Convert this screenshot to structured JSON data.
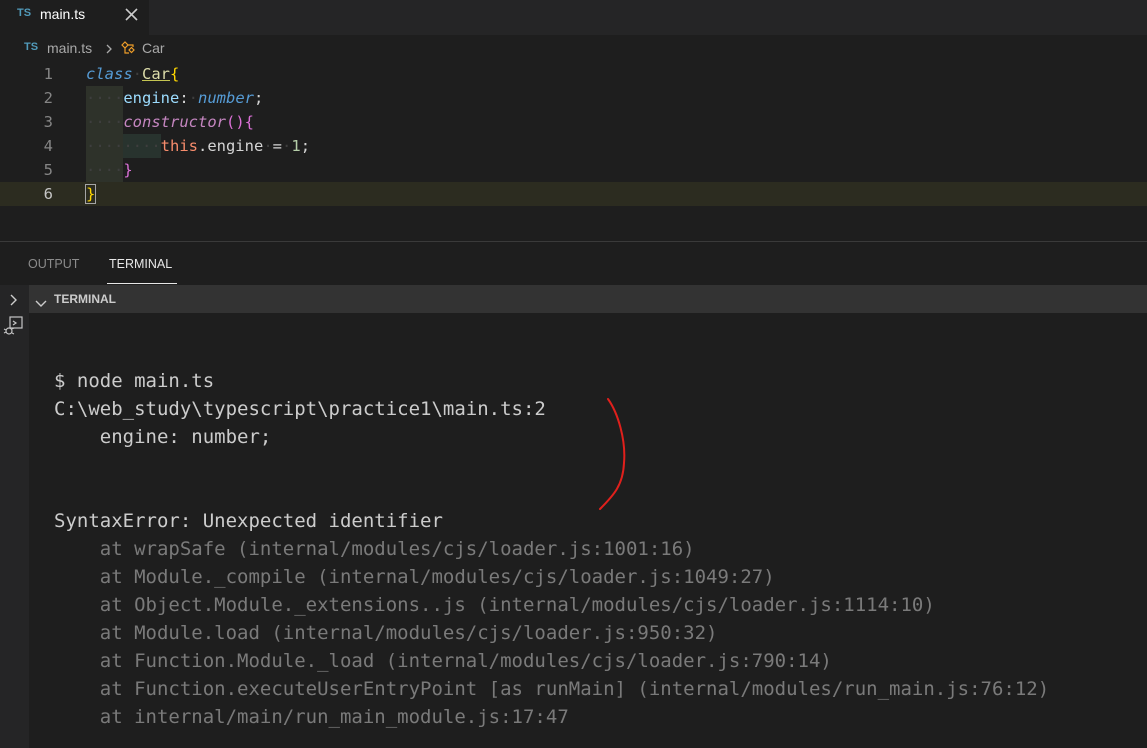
{
  "tab": {
    "lang_badge": "TS",
    "label": "main.ts"
  },
  "breadcrumb": {
    "lang_badge": "TS",
    "file": "main.ts",
    "symbol": "Car"
  },
  "editor": {
    "line_numbers": [
      "1",
      "2",
      "3",
      "4",
      "5",
      "6"
    ],
    "tokens": {
      "class_kw": "class",
      "class_name": "Car",
      "open_brace": "{",
      "engine_prop": "engine",
      "colon": ":",
      "type_number": "number",
      "semicolon": ";",
      "constructor_kw": "constructor",
      "parens": "()",
      "this_kw": "this",
      "dot_engine": ".engine",
      "equals": "=",
      "one": "1",
      "close_brace": "}"
    },
    "current_line": "6"
  },
  "panel": {
    "tabs": [
      "OUTPUT",
      "TERMINAL"
    ],
    "active_tab": "TERMINAL",
    "section_title": "TERMINAL"
  },
  "terminal": {
    "lines": [
      "$ node main.ts",
      "C:\\web_study\\typescript\\practice1\\main.ts:2",
      "    engine: number;",
      "",
      "",
      "SyntaxError: Unexpected identifier"
    ],
    "stack": [
      "    at wrapSafe (internal/modules/cjs/loader.js:1001:16)",
      "    at Module._compile (internal/modules/cjs/loader.js:1049:27)",
      "    at Object.Module._extensions..js (internal/modules/cjs/loader.js:1114:10)",
      "    at Module.load (internal/modules/cjs/loader.js:950:32)",
      "    at Function.Module._load (internal/modules/cjs/loader.js:790:14)",
      "    at Function.executeUserEntryPoint [as runMain] (internal/modules/run_main.js:76:12)",
      "    at internal/main/run_main_module.js:17:47"
    ]
  },
  "colors": {
    "annotation": "#e0201c",
    "accent_ts": "#519aba"
  }
}
